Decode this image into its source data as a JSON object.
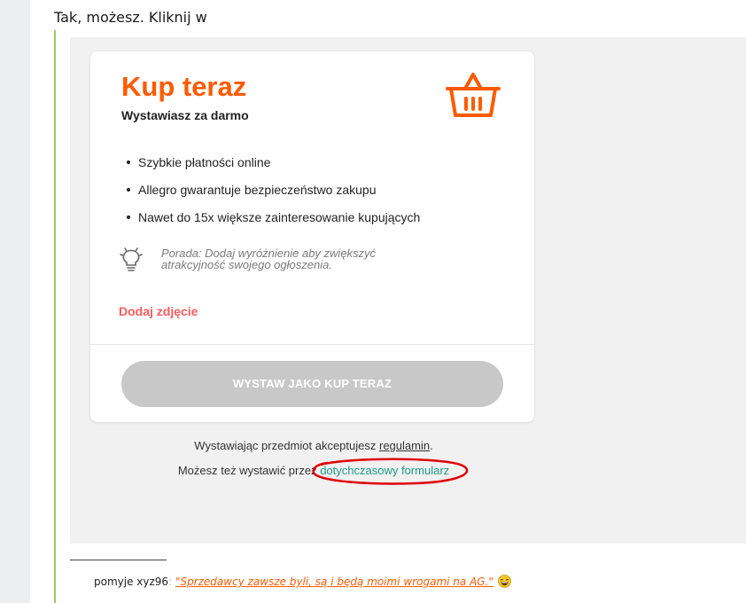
{
  "post": {
    "intro_text": "Tak, możesz. Kliknij w"
  },
  "card": {
    "title": "Kup teraz",
    "subtitle": "Wystawiasz za darmo",
    "basket_icon": "basket-icon",
    "bullets": [
      "Szybkie płatności online",
      "Allegro gwarantuje bezpieczeństwo zakupu",
      "Nawet do 15x większe zainteresowanie kupujących"
    ],
    "tip_icon": "lightbulb-icon",
    "tip_text": "Porada: Dodaj wyróżnienie aby zwiększyć atrakcyjność swojego ogłoszenia.",
    "add_photo_label": "Dodaj zdjęcie",
    "submit_label": "WYSTAW JAKO KUP TERAZ"
  },
  "footer": {
    "accept_prefix": "Wystawiając przedmiot akceptujesz ",
    "accept_link": "regulamin",
    "accept_suffix": ".",
    "alt_prefix": "Możesz też wystawić przez ",
    "alt_link": "dotychczasowy formularz"
  },
  "signature": {
    "prefix": "pomyje xyz96",
    "separator": ":",
    "quote": "\"Sprzedawcy zawsze byli, są i będą moimi wrogami na AG.\"",
    "emoji": "laughing-emoji-icon"
  },
  "colors": {
    "accent": "#ff5a00",
    "add_photo": "#ff5a5a",
    "button_disabled": "#c8c8c8",
    "link_teal": "#1d9a8a",
    "quote_bar": "#9acd5a",
    "annotation_red": "#e00000"
  }
}
